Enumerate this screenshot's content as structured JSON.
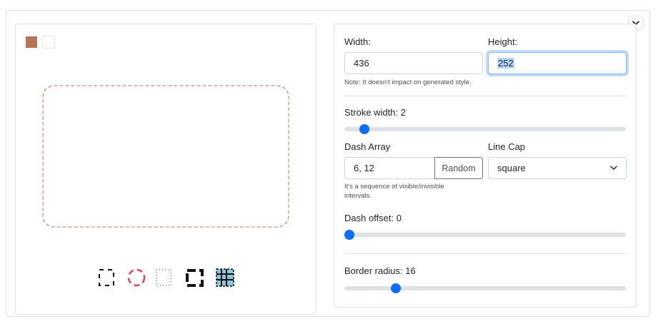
{
  "preview": {
    "foreground_color": "#b87452",
    "background_color": "#ffffff",
    "stroke_color": "#c8704a",
    "presets": [
      {
        "icon": "dashed-square-icon"
      },
      {
        "icon": "dashed-circle-icon",
        "color": "#e8435b"
      },
      {
        "icon": "dotted-square-icon"
      },
      {
        "icon": "thick-dashed-square-icon"
      },
      {
        "icon": "grid-pattern-icon",
        "color": "#8ec7d9"
      }
    ]
  },
  "settings": {
    "width_label": "Width:",
    "width_value": "436",
    "height_label": "Height:",
    "height_value": "252",
    "note": "Note: It doesn't impact on generated style.",
    "stroke_width_label": "Stroke width: 2",
    "stroke_width_value": 2,
    "stroke_width_fraction": 0.055,
    "dash_array_label": "Dash Array",
    "dash_array_value": "6, 12",
    "random_label": "Random",
    "dash_array_help": "It's a sequence of visible/invisible intervals.",
    "line_cap_label": "Line Cap",
    "line_cap_value": "square",
    "dash_offset_label": "Dash offset: 0",
    "dash_offset_value": 0,
    "dash_offset_fraction": 0.0,
    "border_radius_label": "Border radius: 16",
    "border_radius_value": 16,
    "border_radius_fraction": 0.17
  }
}
